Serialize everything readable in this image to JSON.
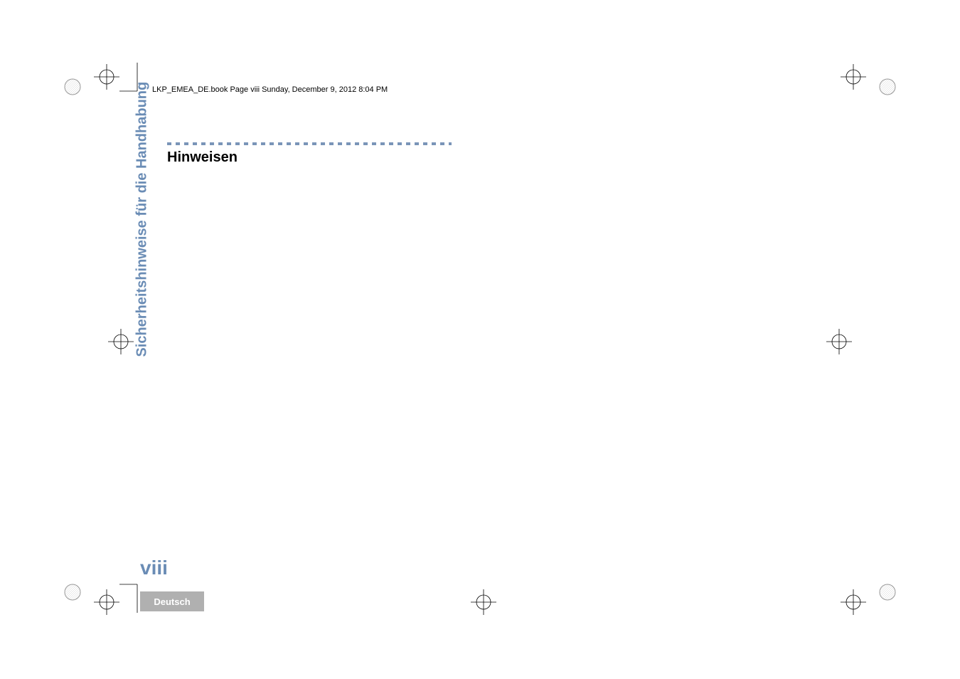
{
  "header": {
    "filename_text": "LKP_EMEA_DE.book  Page viii  Sunday, December 9, 2012  8:04 PM"
  },
  "content": {
    "heading": "Hinweisen",
    "sidebar_title": "Sicherheitshinweise für die Handhabung"
  },
  "footer": {
    "page_number": "viii",
    "language": "Deutsch"
  }
}
